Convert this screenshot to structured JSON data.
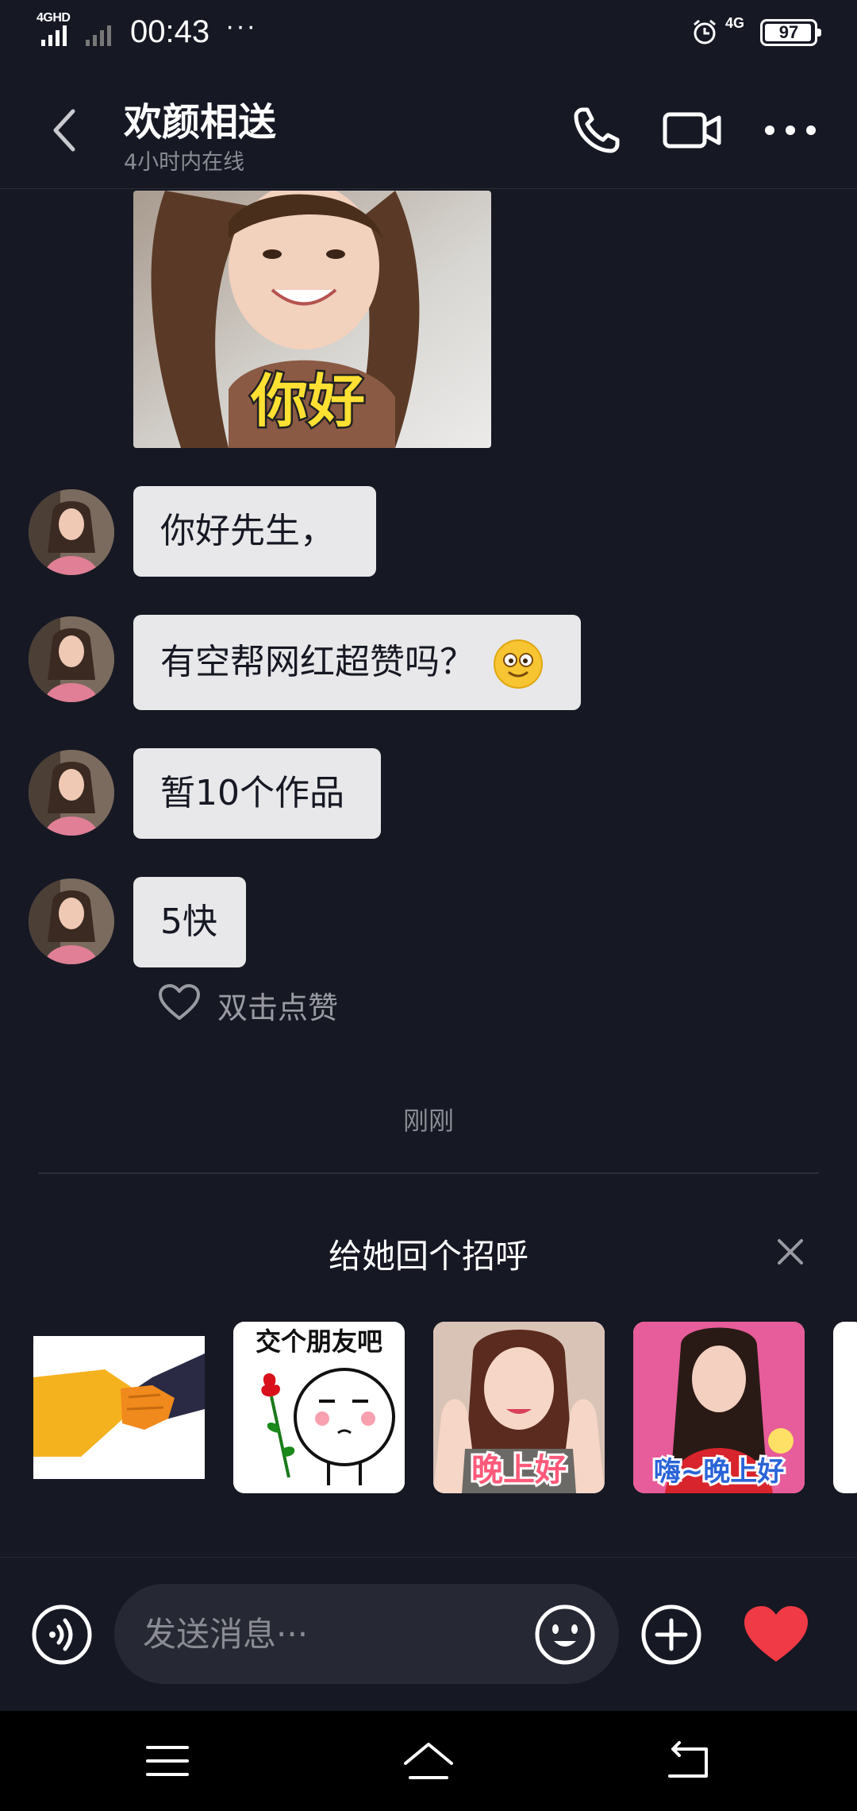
{
  "status_bar": {
    "network_label": "4GHD",
    "time": "00:43",
    "more": "···",
    "net_4g": "4G",
    "battery": "97"
  },
  "header": {
    "contact_name": "欢颜相送",
    "contact_status": "4小时内在线",
    "icons": [
      "back-arrow-icon",
      "phone-icon",
      "video-camera-icon",
      "more-dots-icon"
    ]
  },
  "chat": {
    "sticker_caption": "你好",
    "messages": [
      {
        "text": "你好先生，"
      },
      {
        "text": "有空帮网红超赞吗？"
      },
      {
        "text": "暂10个作品"
      },
      {
        "text": "5快"
      }
    ],
    "like_hint": "双击点赞",
    "timestamp": "刚刚"
  },
  "greeting": {
    "title": "给她回个招呼",
    "stickers": [
      {
        "caption": ""
      },
      {
        "caption": "交个朋友吧"
      },
      {
        "caption": "晚上好"
      },
      {
        "caption": "嗨~晚上好"
      }
    ]
  },
  "input_bar": {
    "placeholder": "发送消息···"
  },
  "colors": {
    "background": "#161823",
    "bubble": "#e8e8ea",
    "heart": "#f03a45",
    "secondary_text": "#8b8c93"
  }
}
